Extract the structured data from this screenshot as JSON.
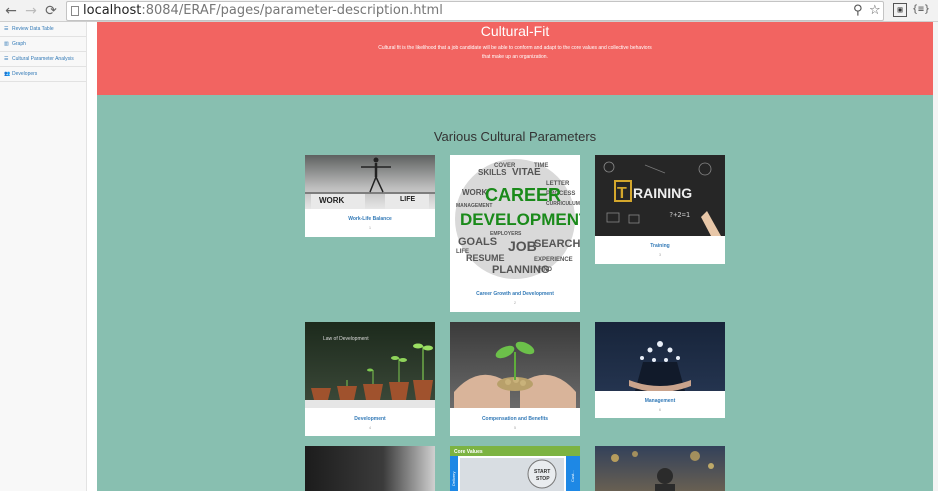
{
  "browser": {
    "url_host": "localhost",
    "url_rest": ":8084/ERAF/pages/parameter-description.html",
    "ext_label": "{≡}"
  },
  "sidebar": {
    "items": [
      {
        "label": "Review Data Table",
        "icon": "table-icon"
      },
      {
        "label": "Graph",
        "icon": "bar-chart-icon"
      },
      {
        "label": "Cultural Parameter Analysis",
        "icon": "table-icon"
      },
      {
        "label": "Developers",
        "icon": "users-icon"
      }
    ]
  },
  "hero": {
    "title": "Cultural-Fit",
    "description": "Cultural fit is the likelihood that a job candidate will be able to conform and adapt to the core values and collective behaviors that make up an organization."
  },
  "section": {
    "title": "Various Cultural Parameters"
  },
  "cards": [
    {
      "caption": "Work-Life Balance",
      "number": "1",
      "image_words": [
        "WORK",
        "LIFE"
      ]
    },
    {
      "caption": "Career Growth and Development",
      "number": "2",
      "image_words": [
        "CAREER",
        "DEVELOPMENT",
        "SKILLS",
        "VITAE",
        "LETTER",
        "PROCESS",
        "WORK",
        "GOALS",
        "JOB",
        "SEARCH",
        "RESUME",
        "PLANNING",
        "EXPERIENCE",
        "MANAGEMENT",
        "EMPLOYERS",
        "CURRICULUM",
        "COVER",
        "TIME",
        "LIFE",
        "FIND"
      ]
    },
    {
      "caption": "Training",
      "number": "3",
      "image_words": [
        "T",
        "RAINING",
        "?+2=1"
      ]
    },
    {
      "caption": "Development",
      "number": "4",
      "image_words": [
        "Law of Development"
      ]
    },
    {
      "caption": "Compensation and Benefits",
      "number": "5",
      "image_words": []
    },
    {
      "caption": "Management",
      "number": "6",
      "image_words": []
    },
    {
      "caption": "",
      "number": "",
      "image_words": []
    },
    {
      "caption": "",
      "number": "",
      "image_words": [
        "Core Values",
        "START",
        "STOP",
        "Delivery",
        "Cust..."
      ]
    },
    {
      "caption": "",
      "number": "",
      "image_words": []
    }
  ],
  "colors": {
    "hero_bg": "#f26461",
    "content_bg": "#88bfb0",
    "link": "#337ab7"
  }
}
